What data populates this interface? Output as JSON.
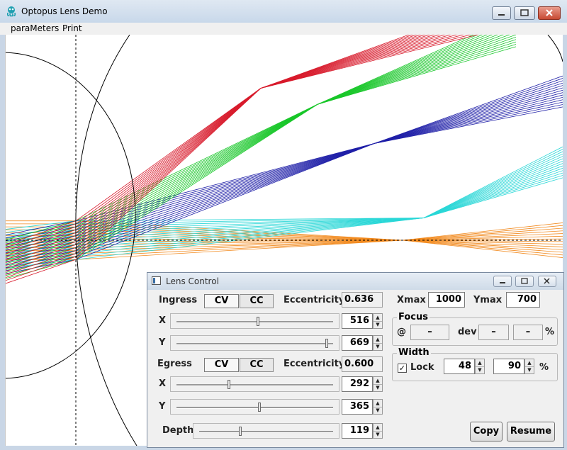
{
  "window": {
    "title": "Optopus Lens Demo",
    "app_icon": "octopus-icon"
  },
  "menu": {
    "items": [
      "paraMeters",
      "Print"
    ]
  },
  "colors": {
    "ray_red": "#d81b2c",
    "ray_green": "#19c72a",
    "ray_blue": "#2020a8",
    "ray_cyan": "#2ad7d7",
    "ray_orange": "#f28a1e"
  },
  "dialog": {
    "title": "Lens Control",
    "ingress": {
      "label": "Ingress",
      "cv": "CV",
      "cc": "CC",
      "eccentricity_label": "Eccentricity",
      "eccentricity": "0.636",
      "x_label": "X",
      "x_value": "516",
      "x_level": 0.52,
      "y_label": "Y",
      "y_value": "669",
      "y_level": 0.97
    },
    "egress": {
      "label": "Egress",
      "cv": "CV",
      "cc": "CC",
      "eccentricity_label": "Eccentricity",
      "eccentricity": "0.600",
      "x_label": "X",
      "x_value": "292",
      "x_level": 0.33,
      "y_label": "Y",
      "y_value": "365",
      "y_level": 0.53
    },
    "depth": {
      "label": "Depth",
      "value": "119",
      "level": 0.3
    },
    "xmax": {
      "label": "Xmax",
      "value": "1000"
    },
    "ymax": {
      "label": "Ymax",
      "value": "700"
    },
    "focus": {
      "label": "Focus",
      "at_label": "@",
      "at_value": "–",
      "dev_label": "dev",
      "dev_value": "–",
      "pct_value": "–",
      "pct_label": "%"
    },
    "width": {
      "label": "Width",
      "lock_label": "Lock",
      "lock_checked": true,
      "value1": "48",
      "value2": "90",
      "pct_label": "%"
    },
    "copy_label": "Copy",
    "resume_label": "Resume"
  }
}
